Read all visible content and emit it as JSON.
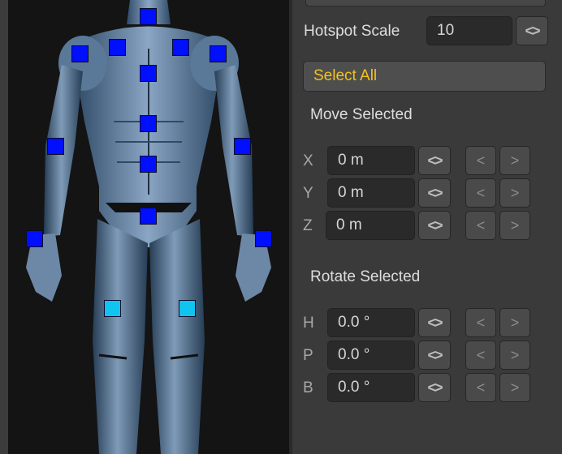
{
  "hotspot": {
    "scale_label": "Hotspot Scale",
    "scale_value": "10",
    "scale_spin": "<>"
  },
  "select_all": "Select All",
  "move": {
    "title": "Move Selected",
    "rows": [
      {
        "axis": "X",
        "value": "0 m",
        "spin": "<>",
        "dec": "<",
        "inc": ">"
      },
      {
        "axis": "Y",
        "value": "0 m",
        "spin": "<>",
        "dec": "<",
        "inc": ">"
      },
      {
        "axis": "Z",
        "value": "0 m",
        "spin": "<>",
        "dec": "<",
        "inc": ">"
      }
    ]
  },
  "rotate": {
    "title": "Rotate Selected",
    "rows": [
      {
        "axis": "H",
        "value": "0.0 °",
        "spin": "<>",
        "dec": "<",
        "inc": ">"
      },
      {
        "axis": "P",
        "value": "0.0 °",
        "spin": "<>",
        "dec": "<",
        "inc": ">"
      },
      {
        "axis": "B",
        "value": "0.0 °",
        "spin": "<>",
        "dec": "<",
        "inc": ">"
      }
    ]
  },
  "colors": {
    "hotspot": "#0010ff",
    "hotspot_selected": "#10c4f0",
    "accent_text": "#f3c21b"
  }
}
